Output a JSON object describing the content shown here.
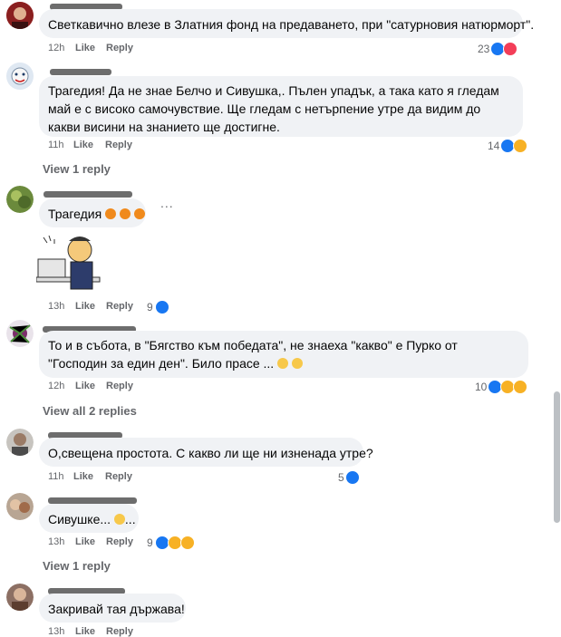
{
  "comments": [
    {
      "text": "Светкавично влезе в Златния фонд на предаването, при \"сатурновия натюрморт\".",
      "time": "12h",
      "like": "Like",
      "reply": "Reply",
      "reactions": "23"
    },
    {
      "text": "Трагедия! Да не знае Белчо и Сивушка,. Пълен упадък, а така като я гледам май е с високо самочувствие. Ще гледам с нетърпение утре да видим до какви висини на знанието ще достигне.",
      "time": "11h",
      "like": "Like",
      "reply": "Reply",
      "reactions": "14",
      "view_replies": "View 1 reply"
    },
    {
      "text": "Трагедия",
      "time": "13h",
      "like": "Like",
      "reply": "Reply",
      "reactions": "9",
      "more": "..."
    },
    {
      "text": "То и в събота, в \"Бягство към победата\", не знаеха \"какво\" е Пурко от \"Господин за един ден\". Било прасе ...",
      "time": "12h",
      "like": "Like",
      "reply": "Reply",
      "reactions": "10",
      "view_replies": "View all 2 replies"
    },
    {
      "text": "О,свещена простота. С какво ли ще ни изненада утре?",
      "time": "11h",
      "like": "Like",
      "reply": "Reply",
      "reactions": "5"
    },
    {
      "text": "Сивушке...",
      "text_end": "...",
      "time": "13h",
      "like": "Like",
      "reply": "Reply",
      "reactions": "9",
      "view_replies": "View 1 reply"
    },
    {
      "text": "Закривай тая държава!",
      "time": "13h",
      "like": "Like",
      "reply": "Reply"
    }
  ],
  "icons": {
    "like": "like-icon",
    "love": "love-icon",
    "haha": "haha-icon",
    "sad": "sad-icon",
    "pumpkin": "pumpkin-emoji"
  },
  "colors": {
    "like": "#1877f2",
    "love": "#f33e58",
    "haha": "#f7b125",
    "bubble": "#f0f2f5",
    "meta": "#65676b"
  }
}
